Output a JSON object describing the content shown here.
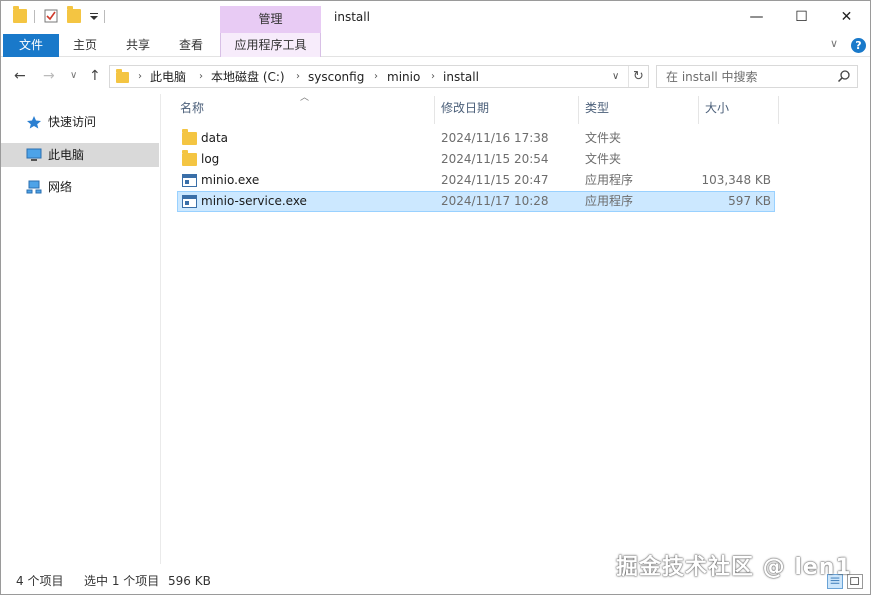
{
  "window": {
    "title": "install",
    "contextual_group": "管理",
    "controls": {
      "minimize": "—",
      "maximize": "☐",
      "close": "✕"
    }
  },
  "ribbon": {
    "tabs": [
      {
        "label": "文件",
        "active": true
      },
      {
        "label": "主页"
      },
      {
        "label": "共享"
      },
      {
        "label": "查看"
      },
      {
        "label": "应用程序工具"
      }
    ],
    "expand": "∨",
    "help": "?"
  },
  "nav": {
    "back": "←",
    "forward": "→",
    "recent": "∨",
    "up": "↑",
    "breadcrumb": [
      "此电脑",
      "本地磁盘 (C:)",
      "sysconfig",
      "minio",
      "install"
    ],
    "separator": "›",
    "dropdown": "∨",
    "refresh": "↻",
    "search_placeholder": "在 install 中搜索"
  },
  "sidebar": {
    "items": [
      {
        "label": "快速访问",
        "icon": "star-icon",
        "selected": false
      },
      {
        "label": "此电脑",
        "icon": "computer-icon",
        "selected": true
      },
      {
        "label": "网络",
        "icon": "network-icon",
        "selected": false
      }
    ]
  },
  "columns": {
    "name": "名称",
    "date": "修改日期",
    "type": "类型",
    "size": "大小"
  },
  "files": [
    {
      "name": "data",
      "date": "2024/11/16 17:38",
      "type": "文件夹",
      "size": "",
      "icon": "folder-icon",
      "selected": false
    },
    {
      "name": "log",
      "date": "2024/11/15 20:54",
      "type": "文件夹",
      "size": "",
      "icon": "folder-icon",
      "selected": false
    },
    {
      "name": "minio.exe",
      "date": "2024/11/15 20:47",
      "type": "应用程序",
      "size": "103,348 KB",
      "icon": "application-icon",
      "selected": false
    },
    {
      "name": "minio-service.exe",
      "date": "2024/11/17 10:28",
      "type": "应用程序",
      "size": "597 KB",
      "icon": "application-icon",
      "selected": true
    }
  ],
  "status": {
    "item_count": "4 个项目",
    "selection": "选中 1 个项目",
    "selection_size": "596 KB"
  },
  "watermark": "掘金技术社区 @ len1",
  "colors": {
    "accent": "#1979ca",
    "manage_tab": "#e8cbf4",
    "selection_bg": "#cce8ff",
    "selection_border": "#99d1ff",
    "folder": "#f4c542"
  }
}
